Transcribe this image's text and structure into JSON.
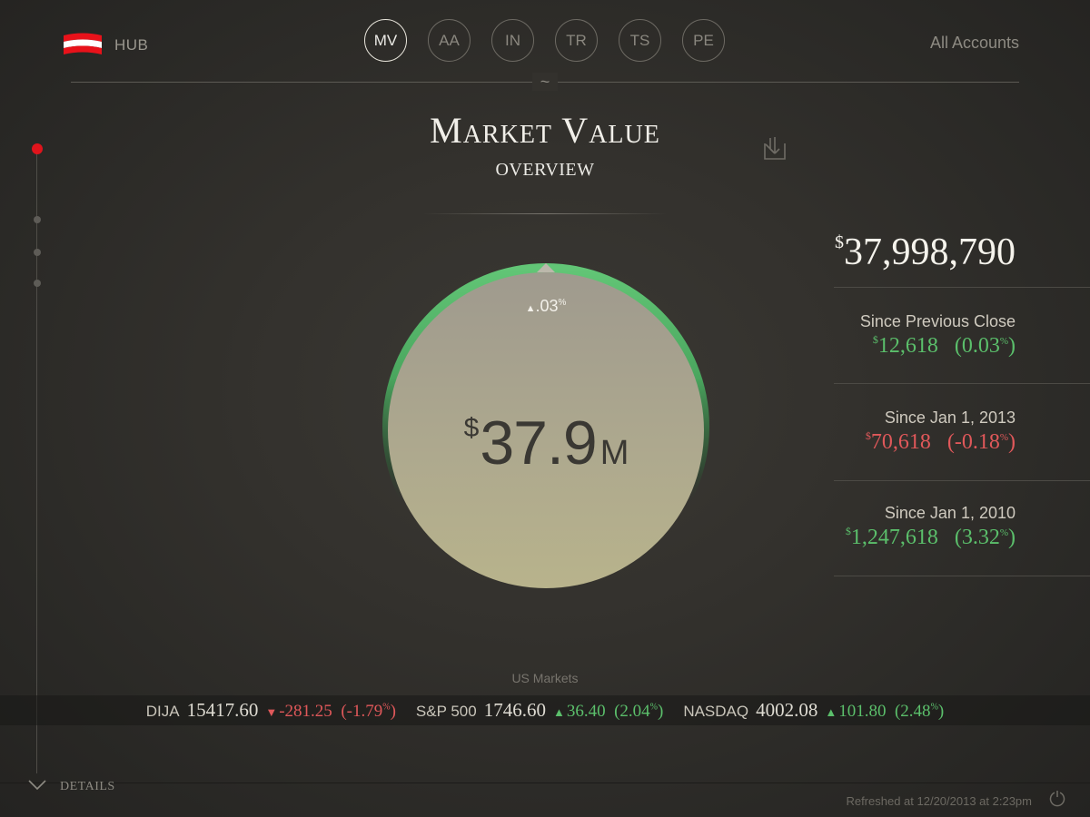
{
  "header": {
    "brand_label": "HUB",
    "accounts_label": "All Accounts",
    "tilde": "~",
    "tabs": [
      {
        "label": "MV",
        "active": true
      },
      {
        "label": "AA",
        "active": false
      },
      {
        "label": "IN",
        "active": false
      },
      {
        "label": "TR",
        "active": false
      },
      {
        "label": "TS",
        "active": false
      },
      {
        "label": "PE",
        "active": false
      }
    ]
  },
  "page": {
    "title": "Market Value",
    "subtitle": "OVERVIEW"
  },
  "gauge": {
    "change_arrow": "▲",
    "change_value": ".03",
    "change_unit": "%",
    "currency": "$",
    "value": "37.9",
    "unit": "M",
    "fill_fraction": 0.0003
  },
  "summary": {
    "currency": "$",
    "total": "37,998,790",
    "stats": [
      {
        "label": "Since Previous Close",
        "amount": "12,618",
        "percent": "(0.03",
        "percent_close": ")",
        "trend": "positive"
      },
      {
        "label": "Since Jan 1, 2013",
        "amount": "70,618",
        "percent": "(-0.18",
        "percent_close": ")",
        "trend": "negative"
      },
      {
        "label": "Since Jan 1, 2010",
        "amount": "1,247,618",
        "percent": "(3.32",
        "percent_close": ")",
        "trend": "positive"
      }
    ]
  },
  "markets": {
    "title": "US Markets",
    "tickers": [
      {
        "symbol": "DIJA",
        "value": "15417.60",
        "arrow": "▼",
        "change": "-281.25",
        "percent": "(-1.79",
        "percent_close": ")",
        "trend": "negative"
      },
      {
        "symbol": "S&P 500",
        "value": "1746.60",
        "arrow": "▲",
        "change": "36.40",
        "percent": "(2.04",
        "percent_close": ")",
        "trend": "positive"
      },
      {
        "symbol": "NASDAQ",
        "value": "4002.08",
        "arrow": "▲",
        "change": "101.80",
        "percent": "(2.48",
        "percent_close": ")",
        "trend": "positive"
      }
    ]
  },
  "footer": {
    "details_label": "DETAILS",
    "refreshed": "Refreshed at 12/20/2013 at 2:23pm"
  },
  "colors": {
    "positive": "#5bbf6b",
    "negative": "#e0585a",
    "accent_red": "#e0141c",
    "gauge_fill": "#b1ac8f"
  },
  "icons": {
    "brand": "flag-logo",
    "download": "download-icon",
    "details": "chevron-down-icon",
    "refresh": "refresh-icon"
  }
}
